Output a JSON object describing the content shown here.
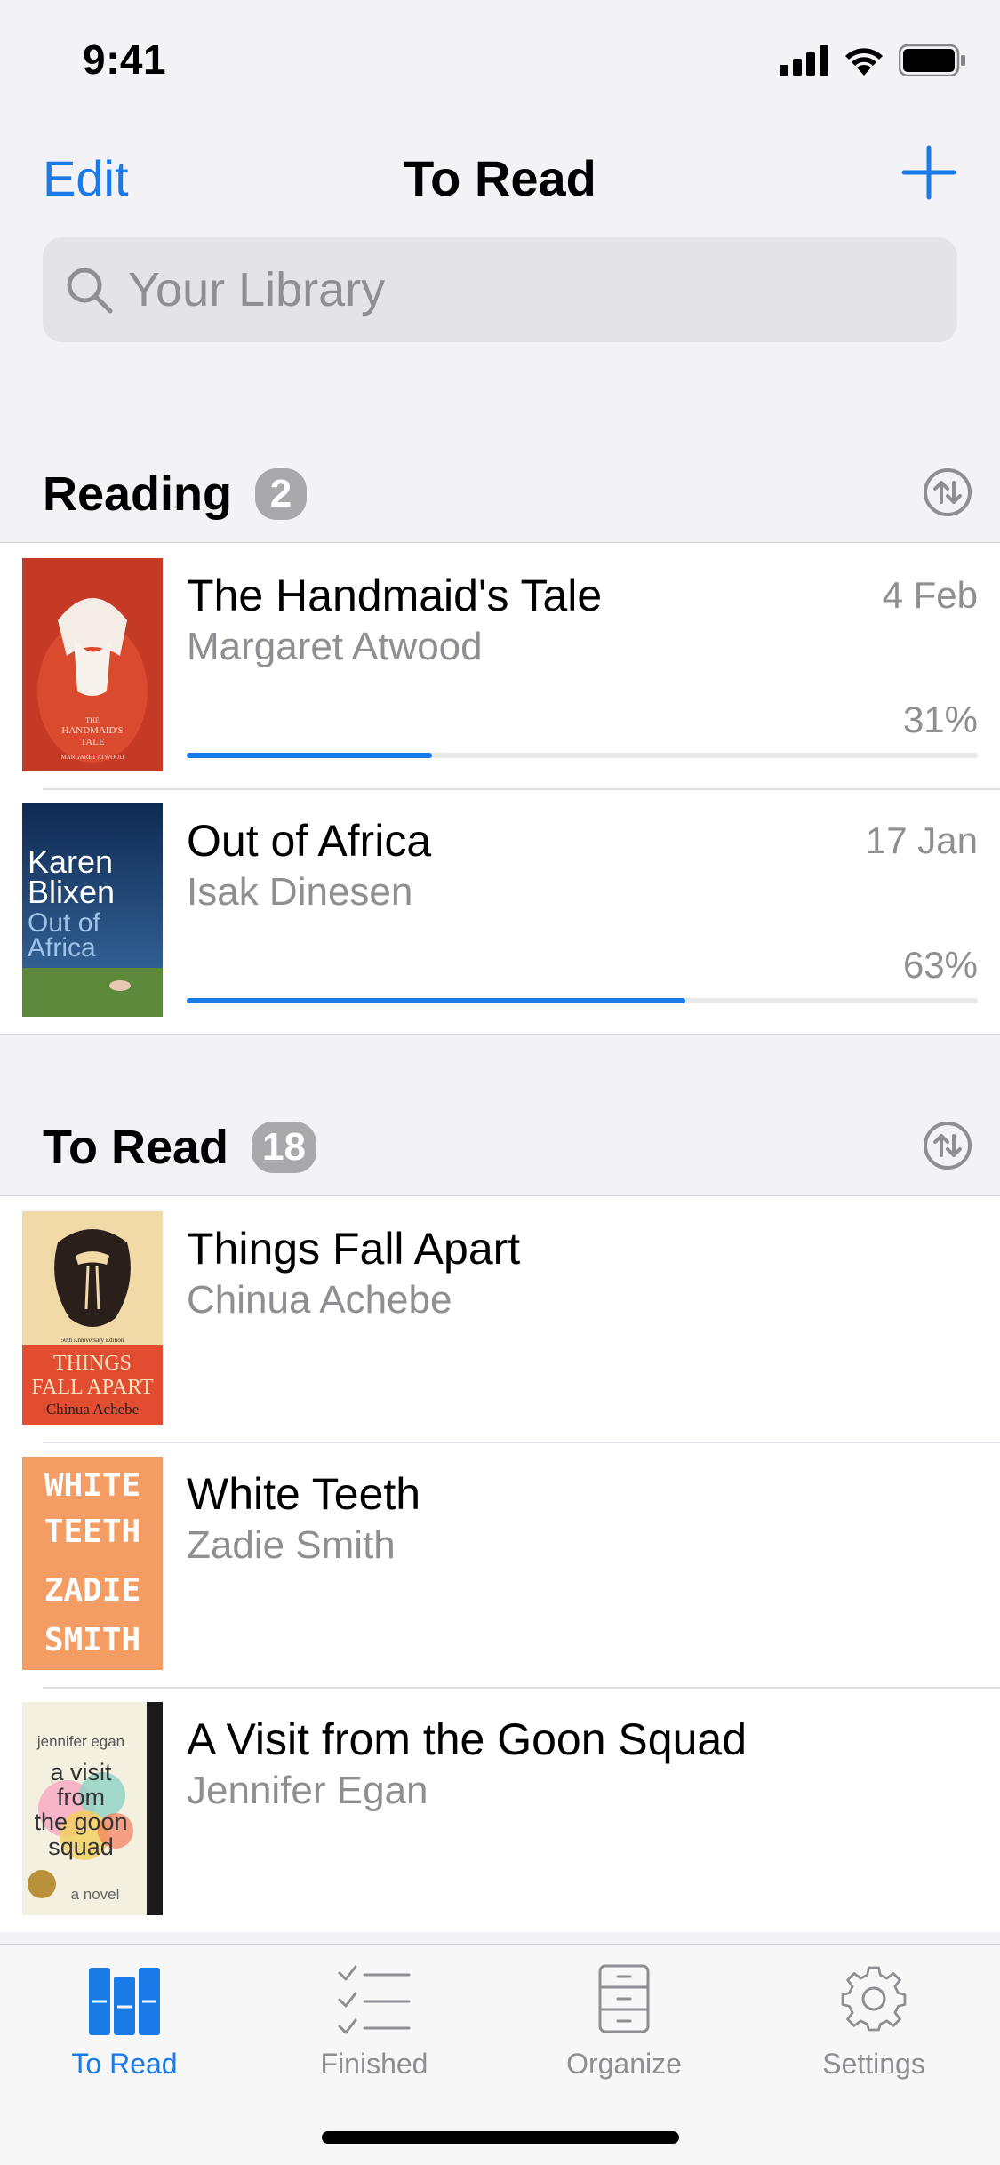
{
  "status": {
    "time": "9:41"
  },
  "nav": {
    "edit": "Edit",
    "title": "To Read",
    "add_icon": "plus-icon"
  },
  "search": {
    "placeholder": "Your Library"
  },
  "reading": {
    "title": "Reading",
    "count": "2",
    "books": [
      {
        "title": "The Handmaid's Tale",
        "author": "Margaret Atwood",
        "date": "4 Feb",
        "progress": "31%",
        "progress_value": 0.31,
        "cover": {
          "bg": "#c53a25",
          "line1": "THE",
          "line2": "HANDMAID'S",
          "line3": "TALE",
          "line4": "MARGARET ATWOOD"
        }
      },
      {
        "title": "Out of Africa",
        "author": "Isak Dinesen",
        "date": "17 Jan",
        "progress": "63%",
        "progress_value": 0.63,
        "cover": {
          "bg": "#173a66",
          "line1": "Karen",
          "line2": "Blixen",
          "line3": "Out of",
          "line4": "Africa"
        }
      }
    ]
  },
  "to_read": {
    "title": "To Read",
    "count": "18",
    "books": [
      {
        "title": "Things Fall Apart",
        "author": "Chinua Achebe",
        "cover": {
          "bg": "#e24c31",
          "line1": "50th Anniversary Edition",
          "line2": "THINGS",
          "line3": "FALL APART",
          "line4": "Chinua Achebe"
        }
      },
      {
        "title": "White Teeth",
        "author": "Zadie Smith",
        "cover": {
          "bg": "#f39c63",
          "line1": "WHITE",
          "line2": "TEETH",
          "line3": "ZADIE",
          "line4": "SMITH"
        }
      },
      {
        "title": "A Visit from the Goon Squad",
        "author": "Jennifer Egan",
        "cover": {
          "bg": "#f4f0df",
          "line1": "jennifer egan",
          "line2": "a visit",
          "line3": "from",
          "line4": "the goon",
          "line5": "squad",
          "line6": "a novel"
        }
      }
    ]
  },
  "tabs": [
    {
      "label": "To Read",
      "icon": "books-icon",
      "active": true
    },
    {
      "label": "Finished",
      "icon": "checklist-icon",
      "active": false
    },
    {
      "label": "Organize",
      "icon": "cabinet-icon",
      "active": false
    },
    {
      "label": "Settings",
      "icon": "gear-icon",
      "active": false
    }
  ],
  "colors": {
    "accent": "#1a7ae8",
    "badge": "#a8a8ad",
    "secondary_text": "#8e8e93"
  }
}
